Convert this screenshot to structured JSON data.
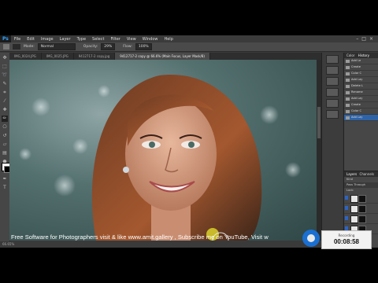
{
  "app": {
    "logo": "Ps"
  },
  "menu": [
    "File",
    "Edit",
    "Image",
    "Layer",
    "Type",
    "Select",
    "Filter",
    "View",
    "Window",
    "Help"
  ],
  "options": {
    "mode_label": "Mode:",
    "mode_value": "Normal",
    "opacity_label": "Opacity:",
    "opacity_value": "29%",
    "flow_label": "Flow:",
    "flow_value": "100%"
  },
  "tabs": [
    {
      "label": "IMG_0024.JPG",
      "active": false
    },
    {
      "label": "IMG_0025.JPG",
      "active": false
    },
    {
      "label": "9412717-2 copy.jpg",
      "active": false
    },
    {
      "label": "9412717-2 copy @ 66.6% (Main Focus, Layer Mask/8)",
      "active": true
    }
  ],
  "status": {
    "zoom": "66.65%"
  },
  "history_panel": {
    "tabs": [
      "Color",
      "History"
    ],
    "items": [
      "Add Le",
      "Create",
      "Color C",
      "Add Lay",
      "Delete L",
      "Rename",
      "Add Lay",
      "Create",
      "Color C",
      "Add Lay"
    ],
    "selected_index": 9
  },
  "layers_panel": {
    "tabs": [
      "Layers",
      "Channels"
    ],
    "kind_label": "Kind",
    "blend_label": "Pass Through",
    "lock_label": "Lock:"
  },
  "overlay": {
    "caption": "Free Software for Photographers visit & like www.amit.gallery , Subscribe me on YouTube,  Visit w"
  },
  "recording": {
    "label": "Recording",
    "time": "00:08:58"
  },
  "colors": {
    "accent": "#2f63a8",
    "record_blue": "#1a6fd1",
    "canvas_teal": "#54706f"
  }
}
